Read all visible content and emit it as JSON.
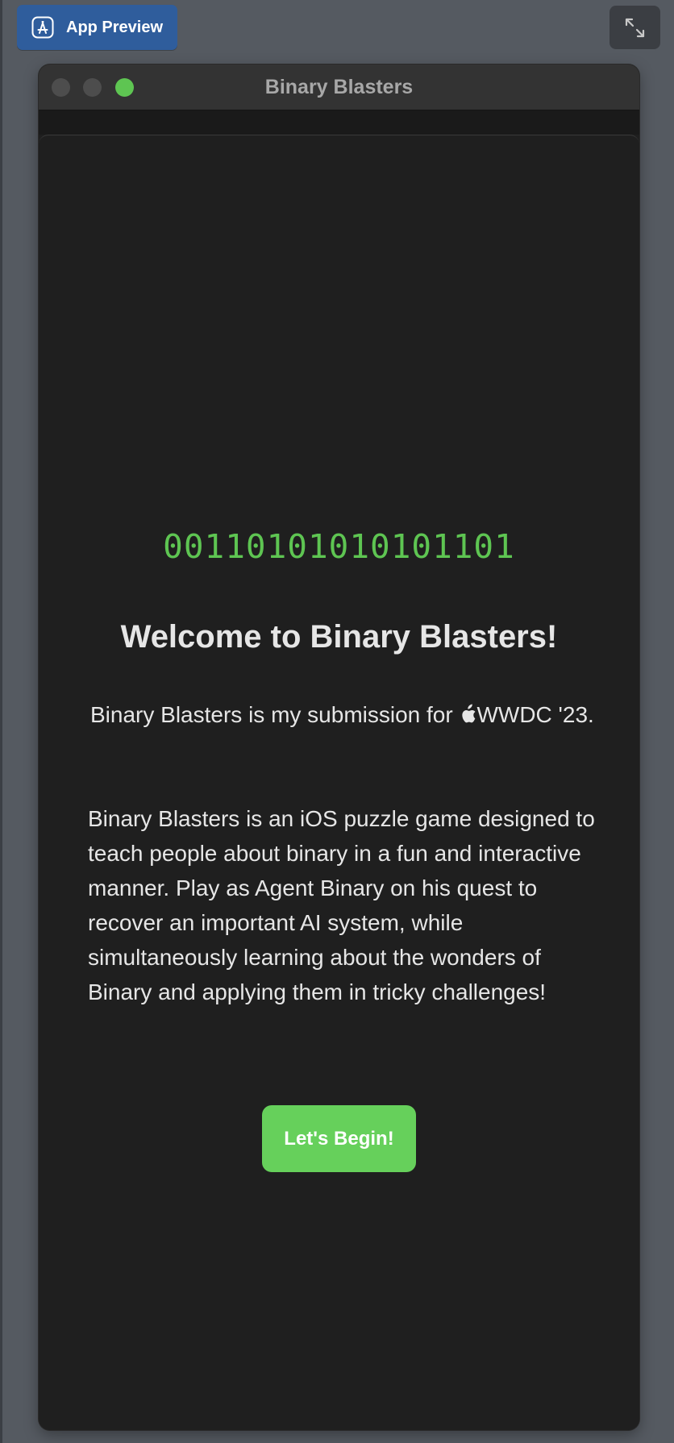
{
  "preview_badge": {
    "label": "App Preview",
    "icon": "app-store-icon"
  },
  "expand_button": {
    "icon": "expand-arrows-icon"
  },
  "window": {
    "title": "Binary Blasters",
    "traffic_lights": {
      "close_color": "#4d4d4d",
      "minimize_color": "#4d4d4d",
      "zoom_color": "#5ec552"
    }
  },
  "welcome": {
    "binary_string": "0011010101010110 1",
    "heading": "Welcome to Binary Blasters!",
    "intro_before_logo": "Binary Blasters is my submission for ",
    "apple_logo": "",
    "intro_after_logo": "WWDC '23.",
    "description": "Binary Blasters is an iOS puzzle game designed to teach people about binary in a fun and interactive manner. Play as Agent Binary on his quest to recover an important AI system, while simultaneously learning about the wonders of Binary and applying them in tricky challenges!",
    "begin_button_label": "Let's Begin!"
  },
  "colors": {
    "accent_green": "#5ec552",
    "button_green": "#66d05b",
    "badge_blue": "#2f5d9c",
    "window_background": "#1f1f1f",
    "text": "#e6e6e6"
  }
}
